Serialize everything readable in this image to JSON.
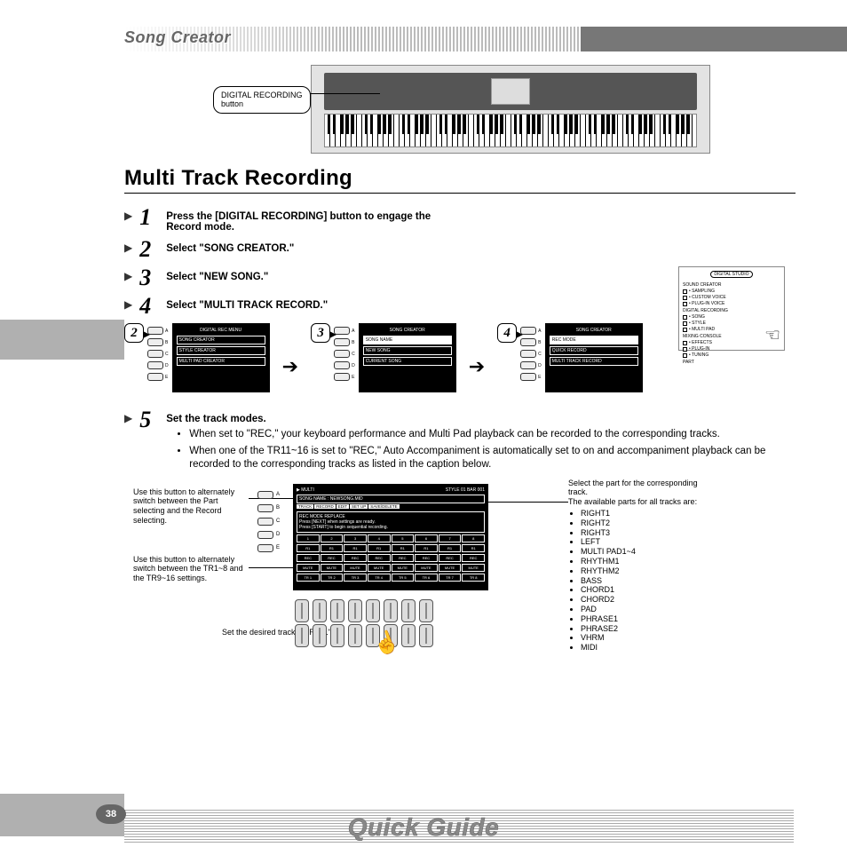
{
  "header": {
    "section_title": "Song Creator"
  },
  "callout": {
    "label_line1": "DIGITAL RECORDING",
    "label_line2": "button"
  },
  "main_heading": "Multi Track Recording",
  "steps": {
    "s1": {
      "num": "1",
      "text_a": "Press the [DIGITAL RECORDING] button to engage the",
      "text_b": "Record mode."
    },
    "s2": {
      "num": "2",
      "text": "Select \"SONG CREATOR.\""
    },
    "s3": {
      "num": "3",
      "text": "Select \"NEW  SONG.\""
    },
    "s4": {
      "num": "4",
      "text": "Select \"MULTI TRACK RECORD.\""
    },
    "s5": {
      "num": "5",
      "heading": "Set the track modes.",
      "bullets": [
        "When set to \"REC,\" your keyboard performance and Multi Pad playback can be recorded to the corresponding tracks.",
        "When one of the TR11~16 is set to \"REC,\" Auto Accompaniment is automatically set to on and accompaniment playback can be recorded to the corresponding tracks as listed in the caption below."
      ]
    }
  },
  "side_panel": {
    "title": "DIGITAL  STUDIO",
    "groups": [
      {
        "label": "SOUND CREATOR",
        "items": [
          "SAMPLING",
          "CUSTOM VOICE",
          "PLUG-IN VOICE"
        ]
      },
      {
        "label": "DIGITAL RECORDING",
        "items": [
          "SONG",
          "STYLE",
          "MULTI PAD"
        ]
      },
      {
        "label": "MIXING CONSOLE",
        "items": [
          "EFFECTS",
          "PLUG-IN",
          "TUNING"
        ]
      }
    ],
    "bottom": "PART"
  },
  "screens": {
    "bubbles": [
      "2",
      "3",
      "4"
    ],
    "btn_labels": [
      "A",
      "B",
      "C",
      "D",
      "E"
    ],
    "lcd2": {
      "title": "DIGITAL REC MENU",
      "items": [
        "SONG CREATOR",
        "STYLE CREATOR",
        "MULTI PAD CREATOR"
      ]
    },
    "lcd3": {
      "title": "SONG CREATOR",
      "tab": "SONG NAME",
      "items": [
        "NEW SONG",
        "CURRENT SONG"
      ]
    },
    "lcd4": {
      "title": "SONG CREATOR",
      "tab": "REC MODE",
      "items": [
        "QUICK RECORD",
        "MULTI TRACK RECORD"
      ]
    }
  },
  "detail": {
    "note_a": "Use this button to alternately switch between the Part selecting and the Record selecting.",
    "note_b": "Use this button to alternately switch between the TR1~8 and the TR9~16 settings.",
    "note_bottom": "Set the desired track to \"REC.\"",
    "note_right_intro": "Select the part for the corresponding track.\nThe available parts for all tracks are:",
    "parts": [
      "RIGHT1",
      "RIGHT2",
      "RIGHT3",
      "LEFT",
      "MULTI PAD1~4",
      "RHYTHM1",
      "RHYTHM2",
      "BASS",
      "CHORD1",
      "CHORD2",
      "PAD",
      "PHRASE1",
      "PHRASE2",
      "VHRM",
      "MIDI"
    ],
    "btn_labels": [
      "A",
      "B",
      "C",
      "D",
      "E"
    ],
    "lcd": {
      "top_left": "MULTI",
      "top_right": "STYLE 01 BAR 001",
      "songname": "SONG NAME : NEWSONG.MID",
      "tabs": [
        "TRACK",
        "RECORD",
        "EDIT",
        "SET UP",
        "SAVE/DELETE"
      ],
      "modes": "REC MODE   REPLACE",
      "msg1": "Press [NEXT] when settings are ready.",
      "msg2": "Press [START] to begin sequential recording.",
      "rec_label": "REC",
      "row_labels_top": [
        "1",
        "2",
        "3",
        "4",
        "5",
        "6",
        "7",
        "8"
      ],
      "row_r": [
        "R1",
        "R1",
        "R1",
        "R1",
        "R1",
        "R1",
        "R1",
        "R1"
      ],
      "row_rec": [
        "REC",
        "REC",
        "REC",
        "REC",
        "REC",
        "REC",
        "REC",
        "REC"
      ],
      "row_mute": [
        "MUTE",
        "MUTE",
        "MUTE",
        "MUTE",
        "MUTE",
        "MUTE",
        "MUTE",
        "MUTE"
      ],
      "row_tr": [
        "TR 1",
        "TR 2",
        "TR 3",
        "TR 4",
        "TR 5",
        "TR 6",
        "TR 7",
        "TR 8"
      ]
    }
  },
  "footer": {
    "title": "Quick Guide",
    "page": "38"
  }
}
